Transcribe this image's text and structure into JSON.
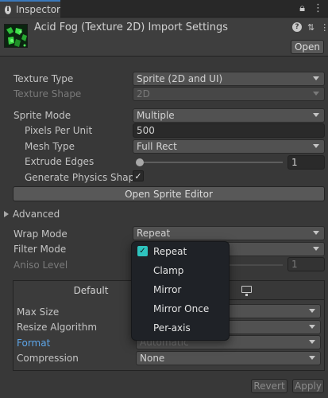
{
  "tab": {
    "title": "Inspector",
    "icons": [
      "lock-icon",
      "kebab-menu-icon"
    ]
  },
  "header": {
    "title": "Acid Fog (Texture 2D) Import Settings",
    "open_label": "Open"
  },
  "fields": {
    "texture_type": {
      "label": "Texture Type",
      "value": "Sprite (2D and UI)"
    },
    "texture_shape": {
      "label": "Texture Shape",
      "value": "2D"
    },
    "sprite_mode": {
      "label": "Sprite Mode",
      "value": "Multiple"
    },
    "pixels_per_unit": {
      "label": "Pixels Per Unit",
      "value": "500"
    },
    "mesh_type": {
      "label": "Mesh Type",
      "value": "Full Rect"
    },
    "extrude_edges": {
      "label": "Extrude Edges",
      "value": "1"
    },
    "generate_physics_shape": {
      "label": "Generate Physics Shape",
      "checked": true
    }
  },
  "open_sprite_editor_label": "Open Sprite Editor",
  "advanced_label": "Advanced",
  "wrap_mode": {
    "label": "Wrap Mode",
    "value": "Repeat"
  },
  "filter_mode": {
    "label": "Filter Mode"
  },
  "aniso_level": {
    "label": "Aniso Level",
    "value": "1"
  },
  "platform": {
    "default_tab": "Default",
    "max_size_label": "Max Size",
    "resize_algorithm_label": "Resize Algorithm",
    "format": {
      "label": "Format",
      "value": "Automatic"
    },
    "compression": {
      "label": "Compression",
      "value": "None"
    }
  },
  "footer": {
    "revert": "Revert",
    "apply": "Apply"
  },
  "wrap_mode_menu": {
    "selected": "Repeat",
    "items": [
      "Repeat",
      "Clamp",
      "Mirror",
      "Mirror Once",
      "Per-axis"
    ]
  },
  "colors": {
    "accent_tab": "#3a79bb",
    "check_teal": "#2ec4bf",
    "format_label_blue": "#5da5e8"
  }
}
